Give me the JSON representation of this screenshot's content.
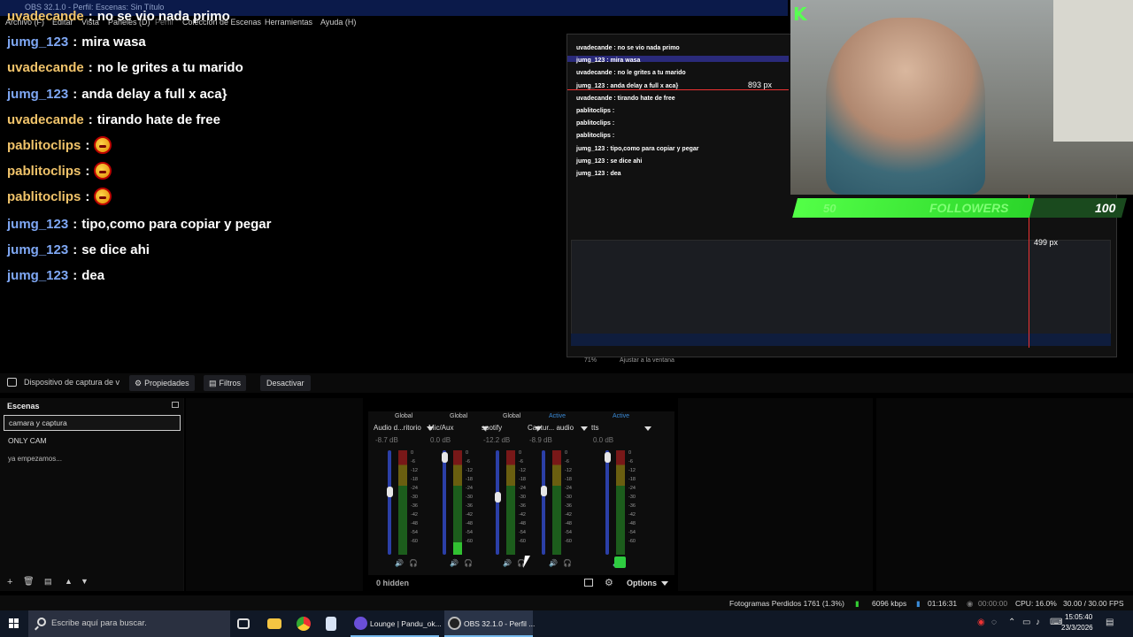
{
  "window": {
    "title": "OBS 32.1.0 - Perfil: Escenas: Sin Título"
  },
  "menu": [
    "Archivo (F)",
    "Editar",
    "Vista",
    "Paneles (D)",
    "Perfil",
    "Colección de Escenas",
    "Herramientas",
    "Ayuda (H)"
  ],
  "chat": {
    "messages": [
      {
        "user": "uvadecande",
        "text": "no se vio nada primo",
        "color": "#f0c36a"
      },
      {
        "user": "jumg_123",
        "text": "mira wasa",
        "color": "#7fa8f5"
      },
      {
        "user": "uvadecande",
        "text": "no le grites a tu marido",
        "color": "#f0c36a"
      },
      {
        "user": "jumg_123",
        "text": "anda delay a full x aca}",
        "color": "#7fa8f5"
      },
      {
        "user": "uvadecande",
        "text": "tirando hate de free",
        "color": "#f0c36a"
      },
      {
        "user": "pablitoclips",
        "text": "",
        "emote": true,
        "color": "#f0c36a"
      },
      {
        "user": "pablitoclips",
        "text": "",
        "emote": true,
        "color": "#f0c36a"
      },
      {
        "user": "pablitoclips",
        "text": "",
        "emote": true,
        "color": "#f0c36a"
      },
      {
        "user": "jumg_123",
        "text": "tipo,como para copiar y pegar",
        "color": "#7fa8f5"
      },
      {
        "user": "jumg_123",
        "text": "se dice ahi",
        "color": "#7fa8f5"
      },
      {
        "user": "jumg_123",
        "text": "dea",
        "color": "#7fa8f5"
      }
    ]
  },
  "preview": {
    "lines": [
      "uvadecande : no se vio nada primo",
      "jumg_123 : mira wasa",
      "uvadecande : no le grites a tu marido",
      "jumg_123 : anda delay a full x aca}",
      "uvadecande : tirando hate de free",
      "pablitoclips :",
      "pablitoclips :",
      "pablitoclips :",
      "jumg_123 : tipo,como para copiar y pegar",
      "jumg_123 : se dice ahi",
      "jumg_123 : dea"
    ],
    "px_top": "893 px",
    "px_right": "499 px",
    "zoom": "71%",
    "fit": "Ajustar a la ventana"
  },
  "followers": {
    "logo": "K",
    "min": "50",
    "label": "FOLLOWERS",
    "max": "100",
    "fill_fraction": 0.72
  },
  "source_toolbar": {
    "source_name": "Dispositivo de captura de v",
    "properties": "Propiedades",
    "filters": "Filtros",
    "deactivate": "Desactivar"
  },
  "scenes": {
    "header": "Escenas",
    "items": [
      "camara y captura",
      "ONLY CAM",
      "ya empezamos..."
    ],
    "active_index": 0
  },
  "mixer": {
    "channels": [
      {
        "head": "Global",
        "name": "Audio d...ritorio",
        "db": "-8.7 dB",
        "fader": 0.65,
        "level": 0.0
      },
      {
        "head": "Global",
        "name": "Mic/Aux",
        "db": "0.0 dB",
        "fader": 0.98,
        "level": 0.12
      },
      {
        "head": "Global",
        "name": "spotify",
        "db": "-12.2 dB",
        "fader": 0.6,
        "level": 0.0
      },
      {
        "head": "Active",
        "name": "Captur... audio",
        "db": "-8.9 dB",
        "fader": 0.66,
        "level": 0.0
      },
      {
        "head": "Active",
        "name": "tts",
        "db": "0.0 dB",
        "fader": 0.98,
        "level": 0.0
      }
    ],
    "scale": [
      "0",
      "-6",
      "-12",
      "-18",
      "-24",
      "-30",
      "-36",
      "-42",
      "-48",
      "-54",
      "-60"
    ],
    "hidden": "0 hidden",
    "options": "Options"
  },
  "status": {
    "dropped": "Fotogramas Perdidos 1761 (1.3%)",
    "bitrate": "6096 kbps",
    "stream_time": "01:16:31",
    "rec_time": "00:00:00",
    "cpu": "CPU: 16.0%",
    "fps": "30.00 / 30.00 FPS"
  },
  "taskbar": {
    "search_placeholder": "Escribe aquí para buscar.",
    "task1": "Lounge | Pandu_ok...",
    "task2": "OBS 32.1.0 - Perfil ...",
    "time": "15:05:40",
    "date": "23/3/2026"
  },
  "colors": {
    "accent": "#3a8ad6",
    "followers_fill": "#53ff47",
    "chat_user_a": "#f0c36a",
    "chat_user_b": "#7fa8f5"
  }
}
